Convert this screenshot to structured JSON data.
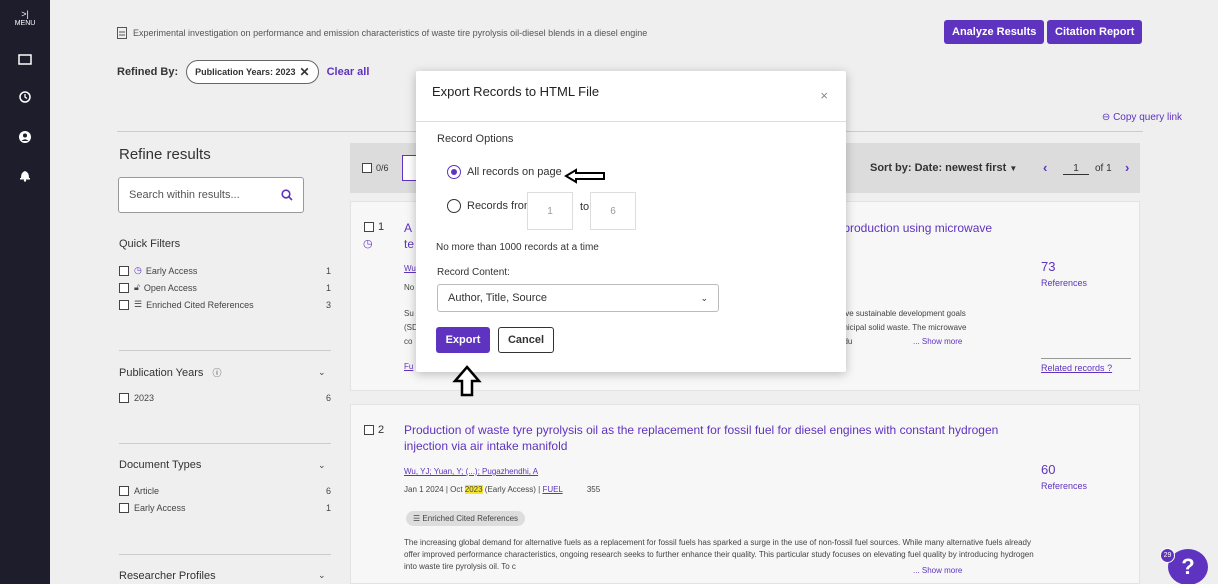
{
  "sidebar": {
    "menu_arrow": ">|",
    "menu_label": "MENU"
  },
  "header": {
    "document_title": "Experimental investigation on performance and emission characteristics of waste tire pyrolysis oil-diesel blends in a diesel engine",
    "analyze_results": "Analyze Results",
    "citation_report": "Citation Report",
    "refined_by": "Refined By:",
    "chip_label": "Publication Years: 2023",
    "clear_all": "Clear all",
    "copy_query_link": "Copy query link"
  },
  "refine": {
    "title": "Refine results",
    "search_placeholder": "Search within results...",
    "quick_filters": {
      "title": "Quick Filters",
      "items": [
        {
          "label": "Early Access",
          "count": "1",
          "icon": "clock-icon"
        },
        {
          "label": "Open Access",
          "count": "1",
          "icon": "lock-open-icon"
        },
        {
          "label": "Enriched Cited References",
          "count": "3",
          "icon": "enriched-refs-icon"
        }
      ]
    },
    "pub_years": {
      "title": "Publication Years",
      "items": [
        {
          "label": "2023",
          "count": "6"
        }
      ]
    },
    "doc_types": {
      "title": "Document Types",
      "items": [
        {
          "label": "Article",
          "count": "6"
        },
        {
          "label": "Early Access",
          "count": "1"
        }
      ]
    },
    "researcher_profiles": {
      "title": "Researcher Profiles"
    }
  },
  "results_bar": {
    "selected": "0/6",
    "sort_by": "Sort by: Date: newest first",
    "page": "1",
    "of": "of 1"
  },
  "records": [
    {
      "num": "1",
      "title_start": "A",
      "title_second_line_start": "te",
      "title_end": "y production using microwave",
      "author_start": "Wu",
      "date_start": "No",
      "abstract": [
        "Su",
        "(SD",
        "co"
      ],
      "abstract_right": [
        "ieve sustainable development goals",
        "unicipal solid waste. The microwave",
        "ndu"
      ],
      "show_more": "Show more",
      "footer_start": "Fu",
      "refs": "73",
      "refs_label": "References",
      "related": "Related records"
    },
    {
      "num": "2",
      "title": "Production of waste tyre pyrolysis oil as the replacement for fossil fuel for diesel engines with constant hydrogen injection via air intake manifold",
      "authors": "Wu, YJ; Yuan, Y; (...); Pugazhendhi, A",
      "date_prefix": "Jan 1 2024 | Oct ",
      "date_year": "2023",
      "date_suffix": " (Early Access) | ",
      "journal": "FUEL",
      "volume": "355",
      "badge": "Enriched Cited References",
      "abstract": "The increasing global demand for alternative fuels as a replacement for fossil fuels has sparked a surge in the use of non-fossil fuel sources. While many alternative fuels already offer improved performance characteristics, ongoing research seeks to further enhance their quality. This particular study focuses on elevating fuel quality by introducing hydrogen into waste tire pyrolysis oil. To c",
      "show_more": "Show more",
      "refs": "60",
      "refs_label": "References"
    }
  ],
  "modal": {
    "title": "Export Records to HTML File",
    "close": "×",
    "record_options": "Record Options",
    "all_records": "All records on page",
    "records_from": "Records from:",
    "from_value": "1",
    "to_label": "to",
    "to_value": "6",
    "limit_note": "No more than 1000 records at a time",
    "record_content": "Record Content:",
    "content_value": "Author, Title, Source",
    "export": "Export",
    "cancel": "Cancel"
  },
  "help": {
    "badge": "29",
    "label": "?"
  },
  "colors": {
    "accent": "#5e33bf",
    "sidebar": "#1d1d2b",
    "highlight": "#f7e62e"
  }
}
